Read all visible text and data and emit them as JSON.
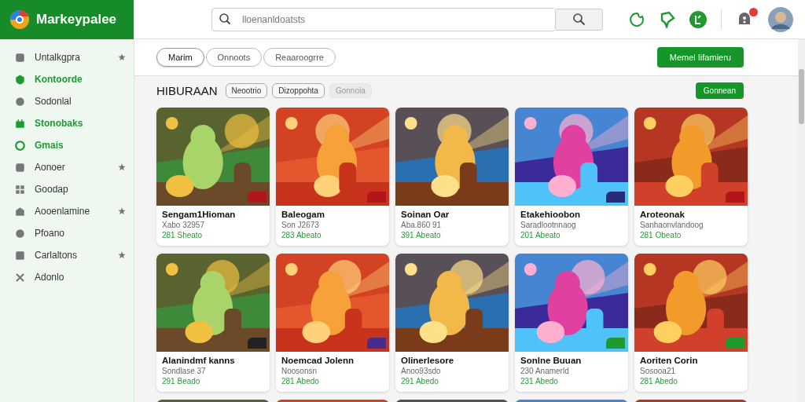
{
  "app": {
    "name": "Markeypalee"
  },
  "search": {
    "placeholder": "lloenanldoatsts"
  },
  "notification": {
    "unread": true
  },
  "sidebar": {
    "items": [
      {
        "label": "Untalkgpra",
        "highlighted": false,
        "starred": true
      },
      {
        "label": "Kontoorde",
        "highlighted": true,
        "starred": false
      },
      {
        "label": "Sodonlal",
        "highlighted": false,
        "starred": false
      },
      {
        "label": "Stonobaks",
        "highlighted": true,
        "starred": false
      },
      {
        "label": "Gmais",
        "highlighted": true,
        "starred": false
      },
      {
        "label": "Aonoer",
        "highlighted": false,
        "starred": true
      },
      {
        "label": "Goodap",
        "highlighted": false,
        "starred": false
      },
      {
        "label": "Aooenlamine",
        "highlighted": false,
        "starred": true
      },
      {
        "label": "Pfoano",
        "highlighted": false,
        "starred": false
      },
      {
        "label": "Carlaltons",
        "highlighted": false,
        "starred": true
      },
      {
        "label": "Adonlo",
        "highlighted": false,
        "starred": false
      }
    ]
  },
  "tabs": [
    {
      "label": "Marim",
      "selected": true
    },
    {
      "label": "Onnoots",
      "selected": false
    },
    {
      "label": "Reaaroogrre",
      "selected": false
    }
  ],
  "primary_button": "Memel Iifamieru",
  "section": {
    "title": "HIBURAAN",
    "chips": [
      {
        "label": "Neootrio",
        "disabled": false
      },
      {
        "label": "Dizoppohta",
        "disabled": false
      },
      {
        "label": "Gonnoia",
        "disabled": true
      }
    ],
    "button": "Gonnean"
  },
  "cards": [
    {
      "kind": "game",
      "title": "Sengam1Hioman",
      "subtitle": "Xabo 32957",
      "meta": "281 Sheato",
      "color": "#b3151b"
    },
    {
      "kind": "game",
      "title": "Baleogam",
      "subtitle": "Son J2673",
      "meta": "283 Abeato",
      "color": "#b3151b"
    },
    {
      "kind": "game",
      "title": "Soinan Oar",
      "subtitle": "Aba.860 91",
      "meta": "391 Abeato"
    },
    {
      "kind": "game",
      "title": "Etakehioobon",
      "subtitle": "Saradlootnnaog",
      "meta": "201 Abeato",
      "color": "#2a2a7a"
    },
    {
      "kind": "game",
      "title": "Aroteonak",
      "subtitle": "Sanhaonvlandoog",
      "meta": "281 Obeato",
      "color": "#b3151b"
    },
    {
      "kind": "game",
      "title": "Alanindmf kanns",
      "subtitle": "Sondlase 37",
      "meta": "291 Beado",
      "color": "#222222"
    },
    {
      "kind": "game",
      "title": "Noemcad Jolenn",
      "subtitle": "Noosonsn",
      "meta": "281 Abedo",
      "color": "#4a2a8a"
    },
    {
      "kind": "game",
      "title": "Olinerlesore",
      "subtitle": "Anoo93sdo",
      "meta": "291 Abedo"
    },
    {
      "kind": "game",
      "title": "Sonlne Buuan",
      "subtitle": "230 Anamerld",
      "meta": "231 Abedo",
      "color": "#1f9a2e"
    },
    {
      "kind": "game",
      "title": "Aoriten Corin",
      "subtitle": "Sosooa21",
      "meta": "281 Abedo",
      "color": "#1f9a2e"
    },
    {
      "kind": "picture"
    },
    {
      "kind": "picture"
    },
    {
      "kind": "picture"
    },
    {
      "kind": "picture"
    },
    {
      "kind": "picture"
    }
  ]
}
